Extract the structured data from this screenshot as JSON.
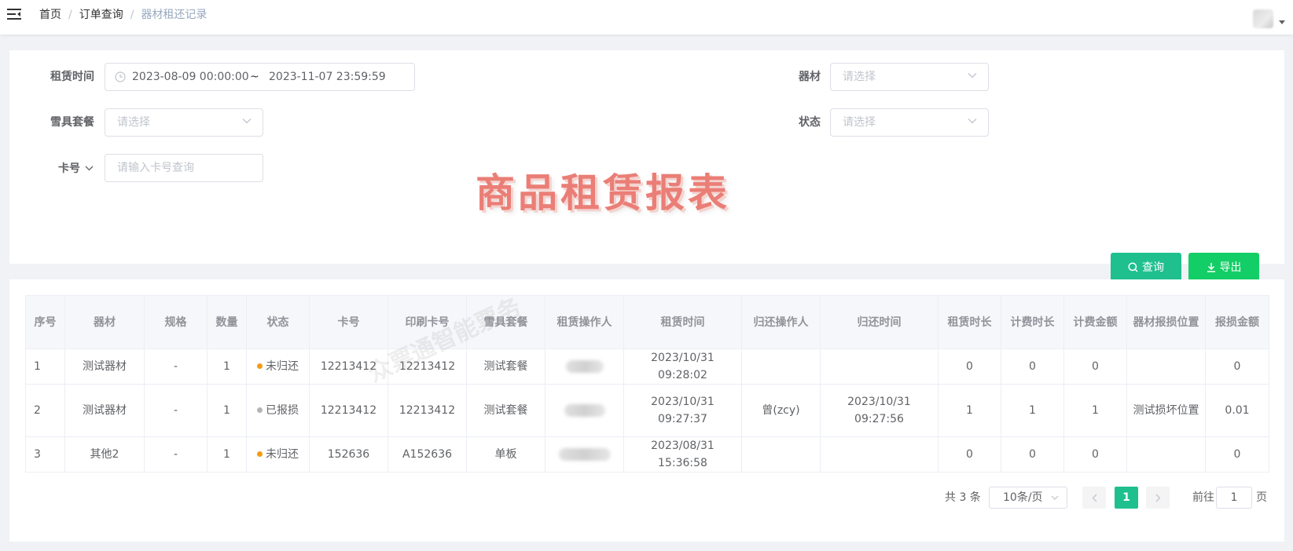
{
  "breadcrumb": [
    "首页",
    "订单查询",
    "器材租还记录"
  ],
  "filters": {
    "rent_time_label": "租赁时间",
    "rent_time_start": "2023-08-09 00:00:00",
    "rent_time_sep": "~",
    "rent_time_end": "2023-11-07 23:59:59",
    "equipment_label": "器材",
    "equipment_placeholder": "请选择",
    "package_label": "雪具套餐",
    "package_placeholder": "请选择",
    "status_label": "状态",
    "status_placeholder": "请选择",
    "card_label": "卡号",
    "card_placeholder": "请输入卡号查询"
  },
  "overlay_title": "商品租赁报表",
  "buttons": {
    "query": "查询",
    "export": "导出"
  },
  "table": {
    "headers": [
      "序号",
      "器材",
      "规格",
      "数量",
      "状态",
      "卡号",
      "印刷卡号",
      "雪具套餐",
      "租赁操作人",
      "租赁时间",
      "归还操作人",
      "归还时间",
      "租赁时长",
      "计费时长",
      "计费金额",
      "器材报损位置",
      "报损金额"
    ],
    "rows": [
      {
        "index": "1",
        "equipment": "测试器材",
        "spec": "-",
        "qty": "1",
        "status": "未归还",
        "status_color": "#f39c12",
        "card": "12213412",
        "print_card": "12213412",
        "package": "测试套餐",
        "rent_operator": "",
        "rent_time": "2023/10/31 09:28:02",
        "return_operator": "",
        "return_time": "",
        "rent_duration": "0",
        "bill_duration": "0",
        "bill_amount": "0",
        "damage_location": "",
        "damage_amount": "0"
      },
      {
        "index": "2",
        "equipment": "测试器材",
        "spec": "-",
        "qty": "1",
        "status": "已报损",
        "status_color": "#b4b4b4",
        "card": "12213412",
        "print_card": "12213412",
        "package": "测试套餐",
        "rent_operator": "",
        "rent_time": "2023/10/31 09:27:37",
        "return_operator": "曾(zcy)",
        "return_time": "2023/10/31 09:27:56",
        "rent_duration": "1",
        "bill_duration": "1",
        "bill_amount": "1",
        "damage_location": "测试损坏位置",
        "damage_amount": "0.01"
      },
      {
        "index": "3",
        "equipment": "其他2",
        "spec": "-",
        "qty": "1",
        "status": "未归还",
        "status_color": "#f39c12",
        "card": "152636",
        "print_card": "A152636",
        "package": "单板",
        "rent_operator": "",
        "rent_time": "2023/08/31 15:36:58",
        "return_operator": "",
        "return_time": "",
        "rent_duration": "0",
        "bill_duration": "0",
        "bill_amount": "0",
        "damage_location": "",
        "damage_amount": "0"
      }
    ]
  },
  "table_watermark": "众票通智能票务",
  "pagination": {
    "total_text": "共 3 条",
    "page_size": "10条/页",
    "current_page": "1",
    "goto_label": "前往",
    "goto_value": "1",
    "page_suffix": "页"
  },
  "colors": {
    "primary": "#1fc08e",
    "export": "#13ce66"
  }
}
